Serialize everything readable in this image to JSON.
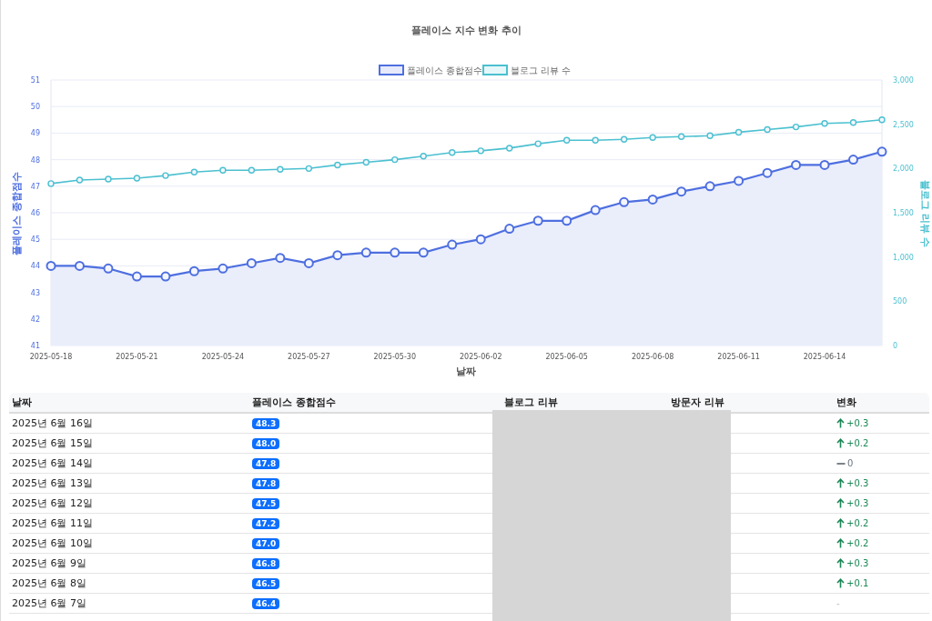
{
  "chart": {
    "chart_data": {
      "type": "line",
      "title": "플레이스 지수 변화 추이",
      "xlabel": "날짜",
      "ylabel": "플레이스 종합점수",
      "y2label": "블로그 리뷰 수",
      "categories": [
        "2025-05-18",
        null,
        null,
        "2025-05-21",
        null,
        null,
        "2025-05-24",
        null,
        null,
        "2025-05-27",
        null,
        null,
        "2025-05-30",
        null,
        null,
        "2025-06-02",
        null,
        null,
        "2025-06-05",
        null,
        null,
        "2025-06-08",
        null,
        null,
        "2025-06-11",
        null,
        null,
        "2025-06-14",
        null,
        null
      ],
      "series": [
        {
          "name": "플레이스 종합점수",
          "color": "#4e6fe0",
          "type": "area",
          "marker": "circle",
          "values": [
            44.0,
            44.0,
            43.9,
            43.6,
            43.6,
            43.8,
            43.9,
            44.1,
            44.3,
            44.1,
            44.4,
            44.5,
            44.5,
            44.5,
            44.8,
            45.0,
            45.4,
            45.7,
            45.7,
            46.1,
            46.4,
            46.5,
            46.8,
            47.0,
            47.2,
            47.5,
            47.8,
            47.8,
            48.0,
            48.3
          ]
        },
        {
          "name": "블로그 리뷰 수",
          "color": "#4bc0d0",
          "type": "line",
          "axis": "y2",
          "marker": "circle",
          "values": [
            1830,
            1870,
            1880,
            1890,
            1920,
            1960,
            1980,
            1980,
            1990,
            2000,
            2040,
            2070,
            2100,
            2140,
            2180,
            2200,
            2230,
            2280,
            2320,
            2320,
            2330,
            2350,
            2360,
            2370,
            2410,
            2440,
            2470,
            2510,
            2520,
            2550
          ]
        }
      ],
      "grid": true,
      "legend": "top",
      "ylim": [
        41,
        51
      ],
      "yticks": [
        41,
        42,
        43,
        44,
        45,
        46,
        47,
        48,
        49,
        50,
        51
      ],
      "y2lim": [
        0,
        3000
      ],
      "y2ticks": [
        {
          "value": 0,
          "label": "0"
        },
        {
          "value": 500,
          "label": "500"
        },
        {
          "value": 1000,
          "label": "1,000"
        },
        {
          "value": 1500,
          "label": "1,500"
        },
        {
          "value": 2000,
          "label": "2,000"
        },
        {
          "value": 2500,
          "label": "2,500"
        },
        {
          "value": 3000,
          "label": "3,000"
        }
      ]
    }
  },
  "table": {
    "columns": [
      "날짜",
      "플레이스 종합점수",
      "블로그 리뷰",
      "방문자 리뷰",
      "변화"
    ],
    "rows": [
      {
        "date": "2025년 6월 16일",
        "score": "48.3",
        "change": {
          "kind": "up",
          "text": "+0.3"
        }
      },
      {
        "date": "2025년 6월 15일",
        "score": "48.0",
        "change": {
          "kind": "up",
          "text": "+0.2"
        }
      },
      {
        "date": "2025년 6월 14일",
        "score": "47.8",
        "change": {
          "kind": "flat",
          "text": "0"
        }
      },
      {
        "date": "2025년 6월 13일",
        "score": "47.8",
        "change": {
          "kind": "up",
          "text": "+0.3"
        }
      },
      {
        "date": "2025년 6월 12일",
        "score": "47.5",
        "change": {
          "kind": "up",
          "text": "+0.3"
        }
      },
      {
        "date": "2025년 6월 11일",
        "score": "47.2",
        "change": {
          "kind": "up",
          "text": "+0.2"
        }
      },
      {
        "date": "2025년 6월 10일",
        "score": "47.0",
        "change": {
          "kind": "up",
          "text": "+0.2"
        }
      },
      {
        "date": "2025년 6월 9일",
        "score": "46.8",
        "change": {
          "kind": "up",
          "text": "+0.3"
        }
      },
      {
        "date": "2025년 6월 8일",
        "score": "46.5",
        "change": {
          "kind": "up",
          "text": "+0.1"
        }
      },
      {
        "date": "2025년 6월 7일",
        "score": "46.4",
        "change": {
          "kind": "none",
          "text": "-"
        }
      }
    ],
    "redacted": true
  }
}
